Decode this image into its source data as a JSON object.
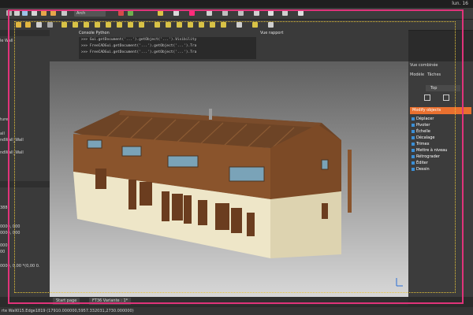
{
  "topbar": {
    "time": "lun. 16"
  },
  "console": {
    "title": "Console Python",
    "lines": [
      ">>> Gui.getDocument('...').getObject('...').Visibility",
      ">>> FreeCADGui.getDocument('...').getObject('...').Tra",
      ">>> FreeCADGui.getDocument('...').getObject('...').Tra"
    ]
  },
  "report": {
    "title": "Vue rapport"
  },
  "toolbar": {
    "zoom": "Arch"
  },
  "leftpanel": {
    "items": [
      "le Wall",
      "",
      "",
      "",
      "",
      "ture",
      "",
      "all",
      "ndWall_Wall",
      "",
      "ndWall_Wall",
      "",
      "",
      "",
      "",
      "",
      "",
      "",
      "",
      "",
      "388",
      "",
      "",
      "",
      "0000, 000",
      "0000, 000",
      "",
      "000",
      "00",
      "",
      "",
      "0000, 0.00 *(0,00 0."
    ]
  },
  "rightpanel": {
    "title": "Vue combinée",
    "tab_model": "Modèle",
    "tab_tasks": "Tâches",
    "view_select": "Top",
    "modify_header": "Modify objects",
    "tasks": [
      "Déplacer",
      "Pivoter",
      "Échelle",
      "Décalage",
      "Trimex",
      "Mettre à niveau",
      "Rétrograder",
      "Éditer",
      "Dessin"
    ]
  },
  "tabs": {
    "start": "Start page",
    "doc": "FT36 Variante : 1*"
  },
  "status": {
    "text": "rte Wall015.Edge1819 (17910.000000,5957.332031,2730.000000)"
  }
}
